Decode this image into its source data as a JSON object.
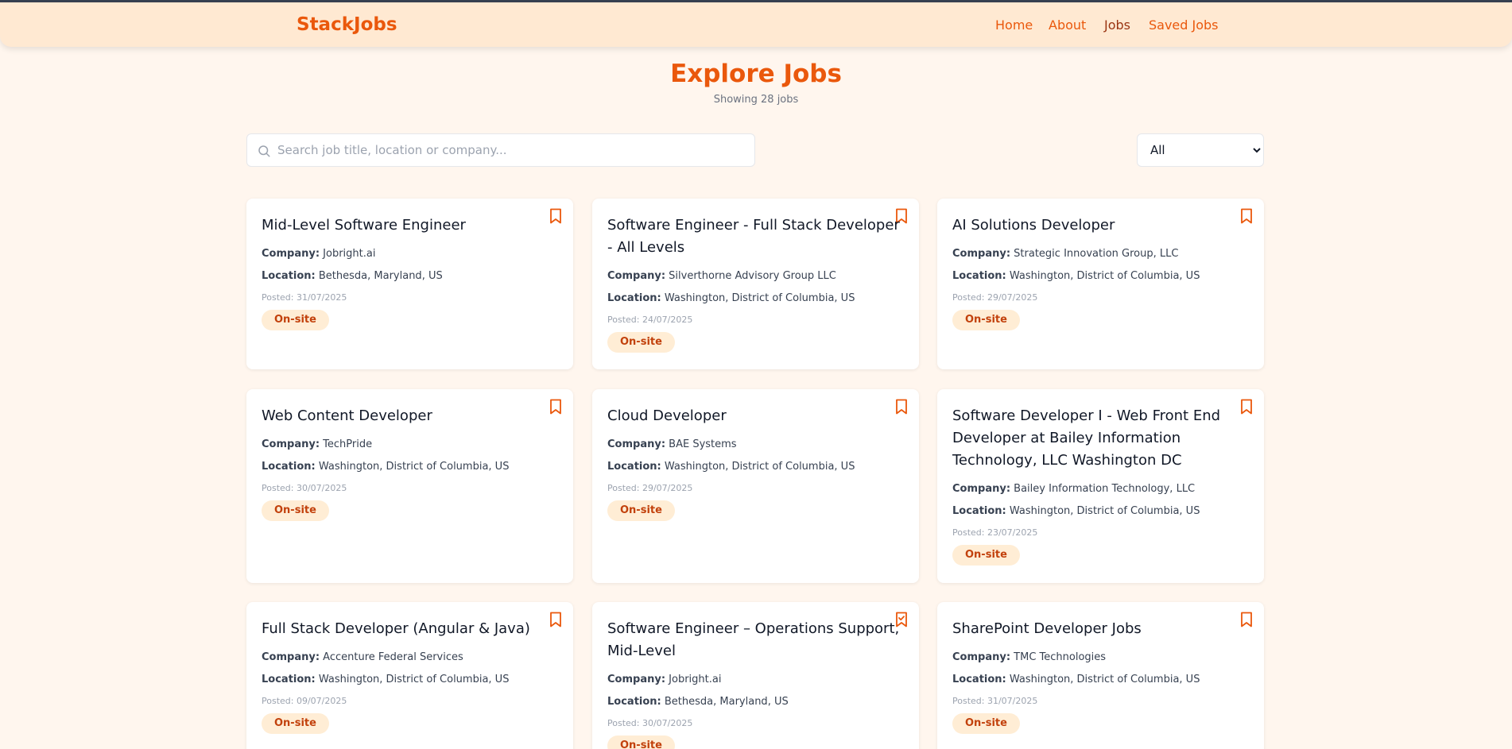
{
  "nav": {
    "brand": "StackJobs",
    "links": [
      "Home",
      "About",
      "Jobs",
      "Saved Jobs"
    ]
  },
  "header": {
    "title": "Explore Jobs",
    "subtitle": "Showing 28 jobs"
  },
  "search": {
    "placeholder": "Search job title, location or company..."
  },
  "filter": {
    "selected": "All"
  },
  "labels": {
    "company": "Company:",
    "location": "Location:"
  },
  "jobs": [
    {
      "title": "Mid-Level Software Engineer",
      "company": "Jobright.ai",
      "location": "Bethesda, Maryland, US",
      "posted": "Posted: 31/07/2025",
      "type": "On-site",
      "saved": false
    },
    {
      "title": "Software Engineer - Full Stack Developer - All Levels",
      "company": "Silverthorne Advisory Group LLC",
      "location": "Washington, District of Columbia, US",
      "posted": "Posted: 24/07/2025",
      "type": "On-site",
      "saved": false
    },
    {
      "title": "AI Solutions Developer",
      "company": "Strategic Innovation Group, LLC",
      "location": "Washington, District of Columbia, US",
      "posted": "Posted: 29/07/2025",
      "type": "On-site",
      "saved": false
    },
    {
      "title": "Web Content Developer",
      "company": "TechPride",
      "location": "Washington, District of Columbia, US",
      "posted": "Posted: 30/07/2025",
      "type": "On-site",
      "saved": false
    },
    {
      "title": "Cloud Developer",
      "company": "BAE Systems",
      "location": "Washington, District of Columbia, US",
      "posted": "Posted: 29/07/2025",
      "type": "On-site",
      "saved": false
    },
    {
      "title": "Software Developer I - Web Front End Developer at Bailey Information Technology, LLC Washington DC",
      "company": "Bailey Information Technology, LLC",
      "location": "Washington, District of Columbia, US",
      "posted": "Posted: 23/07/2025",
      "type": "On-site",
      "saved": false
    },
    {
      "title": "Full Stack Developer (Angular & Java)",
      "company": "Accenture Federal Services",
      "location": "Washington, District of Columbia, US",
      "posted": "Posted: 09/07/2025",
      "type": "On-site",
      "saved": false
    },
    {
      "title": "Software Engineer – Operations Support, Mid-Level",
      "company": "Jobright.ai",
      "location": "Bethesda, Maryland, US",
      "posted": "Posted: 30/07/2025",
      "type": "On-site",
      "saved": true
    },
    {
      "title": "SharePoint Developer Jobs",
      "company": "TMC Technologies",
      "location": "Washington, District of Columbia, US",
      "posted": "Posted: 31/07/2025",
      "type": "On-site",
      "saved": false
    }
  ],
  "colors": {
    "accent": "#ea580c",
    "background": "#fff6ee",
    "badge_bg": "#ffedd5",
    "navbar_bg": "#ffe9d2"
  }
}
